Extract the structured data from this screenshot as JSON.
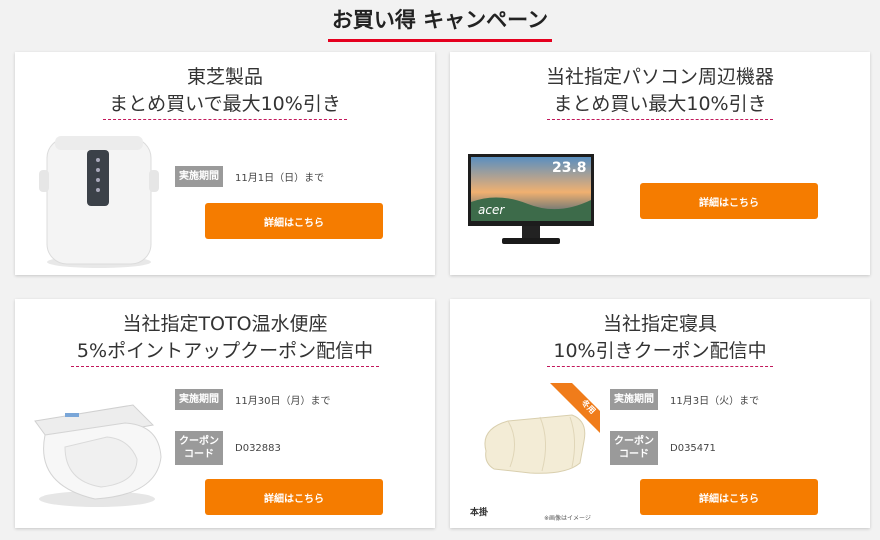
{
  "heading": "お買い得 キャンペーン",
  "cards": [
    {
      "title1": "東芝製品",
      "title2": "まとめ買いで最大10%引き",
      "period_label": "実施期間",
      "period_value": "11月1日（日）まで",
      "button_label": "詳細はこちら"
    },
    {
      "title1": "当社指定パソコン周辺機器",
      "title2": "まとめ買い最大10%引き",
      "monitor_size": "23.8",
      "monitor_brand": "acer",
      "button_label": "詳細はこちら"
    },
    {
      "title1": "当社指定TOTO温水便座",
      "title2": "5%ポイントアップクーポン配信中",
      "period_label": "実施期間",
      "period_value": "11月30日（月）まで",
      "coupon_label": "クーポンコード",
      "coupon_value": "D032883",
      "button_label": "詳細はこちら"
    },
    {
      "title1": "当社指定寝具",
      "title2": "10%引きクーポン配信中",
      "badge": "冬用",
      "caption_left": "本掛",
      "caption_right": "※画像はイメージ",
      "period_label": "実施期間",
      "period_value": "11月3日（火）まで",
      "coupon_label": "クーポンコード",
      "coupon_value": "D035471",
      "button_label": "詳細はこちら"
    }
  ],
  "colors": {
    "accent_button": "#f57c00",
    "heading_underline": "#e5001f",
    "label_background": "#9a9a9a"
  }
}
